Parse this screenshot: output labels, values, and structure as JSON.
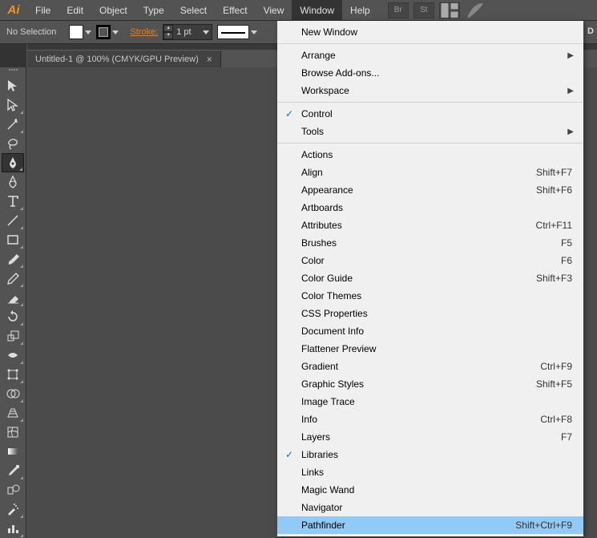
{
  "app": {
    "logo": "Ai"
  },
  "menus": [
    "File",
    "Edit",
    "Object",
    "Type",
    "Select",
    "Effect",
    "View",
    "Window",
    "Help"
  ],
  "menu_open_index": 7,
  "toolbar_icons": [
    "Br",
    "St"
  ],
  "options": {
    "selection_status": "No Selection",
    "stroke_label": "Stroke:",
    "stroke_value": "1 pt"
  },
  "docTab": {
    "title": "Untitled-1 @ 100% (CMYK/GPU Preview)"
  },
  "right_char": "D",
  "window_menu": [
    {
      "type": "item",
      "label": "New Window"
    },
    {
      "type": "sep"
    },
    {
      "type": "item",
      "label": "Arrange",
      "submenu": true
    },
    {
      "type": "item",
      "label": "Browse Add-ons..."
    },
    {
      "type": "item",
      "label": "Workspace",
      "submenu": true
    },
    {
      "type": "sep"
    },
    {
      "type": "item",
      "label": "Control",
      "checked": true
    },
    {
      "type": "item",
      "label": "Tools",
      "submenu": true
    },
    {
      "type": "sep"
    },
    {
      "type": "item",
      "label": "Actions"
    },
    {
      "type": "item",
      "label": "Align",
      "shortcut": "Shift+F7"
    },
    {
      "type": "item",
      "label": "Appearance",
      "shortcut": "Shift+F6"
    },
    {
      "type": "item",
      "label": "Artboards"
    },
    {
      "type": "item",
      "label": "Attributes",
      "shortcut": "Ctrl+F11"
    },
    {
      "type": "item",
      "label": "Brushes",
      "shortcut": "F5"
    },
    {
      "type": "item",
      "label": "Color",
      "shortcut": "F6"
    },
    {
      "type": "item",
      "label": "Color Guide",
      "shortcut": "Shift+F3"
    },
    {
      "type": "item",
      "label": "Color Themes"
    },
    {
      "type": "item",
      "label": "CSS Properties"
    },
    {
      "type": "item",
      "label": "Document Info"
    },
    {
      "type": "item",
      "label": "Flattener Preview"
    },
    {
      "type": "item",
      "label": "Gradient",
      "shortcut": "Ctrl+F9"
    },
    {
      "type": "item",
      "label": "Graphic Styles",
      "shortcut": "Shift+F5"
    },
    {
      "type": "item",
      "label": "Image Trace"
    },
    {
      "type": "item",
      "label": "Info",
      "shortcut": "Ctrl+F8"
    },
    {
      "type": "item",
      "label": "Layers",
      "shortcut": "F7"
    },
    {
      "type": "item",
      "label": "Libraries",
      "checked": true
    },
    {
      "type": "item",
      "label": "Links"
    },
    {
      "type": "item",
      "label": "Magic Wand"
    },
    {
      "type": "item",
      "label": "Navigator"
    },
    {
      "type": "item",
      "label": "Pathfinder",
      "shortcut": "Shift+Ctrl+F9",
      "highlight": true
    }
  ],
  "tools": [
    {
      "name": "selection",
      "corner": false
    },
    {
      "name": "direct-selection",
      "corner": true
    },
    {
      "name": "magic-wand",
      "corner": true
    },
    {
      "name": "lasso",
      "corner": false
    },
    {
      "name": "pen",
      "selected": true,
      "corner": true
    },
    {
      "name": "curvature",
      "corner": false
    },
    {
      "name": "type",
      "corner": true
    },
    {
      "name": "line",
      "corner": true
    },
    {
      "name": "rectangle",
      "corner": true
    },
    {
      "name": "paintbrush",
      "corner": true
    },
    {
      "name": "pencil",
      "corner": true
    },
    {
      "name": "eraser",
      "corner": true
    },
    {
      "name": "rotate",
      "corner": true
    },
    {
      "name": "scale",
      "corner": true
    },
    {
      "name": "width",
      "corner": true
    },
    {
      "name": "free-transform",
      "corner": true
    },
    {
      "name": "shape-builder",
      "corner": true
    },
    {
      "name": "perspective",
      "corner": true
    },
    {
      "name": "mesh",
      "corner": false
    },
    {
      "name": "gradient",
      "corner": false
    },
    {
      "name": "eyedropper",
      "corner": true
    },
    {
      "name": "blend",
      "corner": false
    },
    {
      "name": "symbol-sprayer",
      "corner": true
    },
    {
      "name": "column-graph",
      "corner": true
    }
  ]
}
